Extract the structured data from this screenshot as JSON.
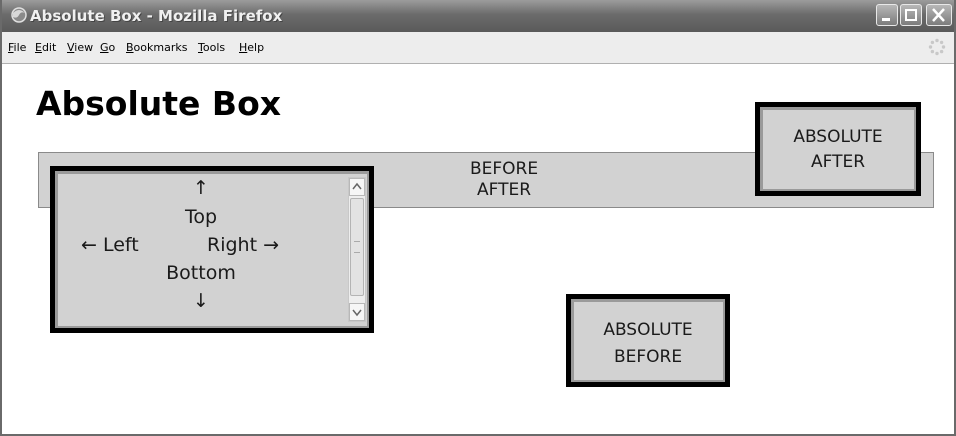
{
  "window": {
    "title": "Absolute Box - Mozilla Firefox"
  },
  "menu": {
    "items": [
      {
        "label": "File",
        "key": "file"
      },
      {
        "label": "Edit",
        "key": "edit"
      },
      {
        "label": "View",
        "key": "view"
      },
      {
        "label": "Go",
        "key": "go"
      },
      {
        "label": "Bookmarks",
        "key": "bookmarks"
      },
      {
        "label": "Tools",
        "key": "tools"
      },
      {
        "label": "Help",
        "key": "help"
      }
    ]
  },
  "page": {
    "heading": "Absolute Box",
    "band": {
      "line1": "BEFORE",
      "line2": "AFTER"
    },
    "scroll_box": {
      "up_arrow": "↑",
      "top": "Top",
      "left": "← Left",
      "right": "Right →",
      "bottom": "Bottom",
      "down_arrow": "↓"
    },
    "absolute_after": {
      "line1": "ABSOLUTE",
      "line2": "AFTER"
    },
    "absolute_before": {
      "line1": "ABSOLUTE",
      "line2": "BEFORE"
    }
  },
  "colors": {
    "box_fill": "#d2d2d2",
    "box_border": "#000000",
    "titlebar": "#6b6b6b"
  },
  "icons": [
    "firefox-icon",
    "minimize-icon",
    "maximize-icon",
    "close-icon",
    "throbber-icon",
    "scroll-up-icon",
    "scroll-down-icon"
  ]
}
